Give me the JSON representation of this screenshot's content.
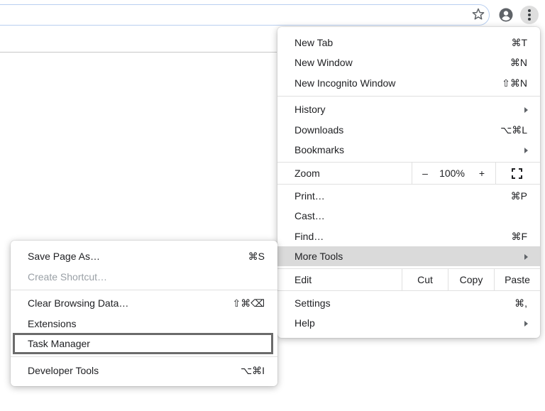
{
  "menu": {
    "new_tab": {
      "label": "New Tab",
      "shortcut": "⌘T"
    },
    "new_window": {
      "label": "New Window",
      "shortcut": "⌘N"
    },
    "new_incognito": {
      "label": "New Incognito Window",
      "shortcut": "⇧⌘N"
    },
    "history": {
      "label": "History"
    },
    "downloads": {
      "label": "Downloads",
      "shortcut": "⌥⌘L"
    },
    "bookmarks": {
      "label": "Bookmarks"
    },
    "zoom": {
      "label": "Zoom",
      "minus": "–",
      "level": "100%",
      "plus": "+"
    },
    "print": {
      "label": "Print…",
      "shortcut": "⌘P"
    },
    "cast": {
      "label": "Cast…"
    },
    "find": {
      "label": "Find…",
      "shortcut": "⌘F"
    },
    "more_tools": {
      "label": "More Tools"
    },
    "edit": {
      "label": "Edit",
      "cut": "Cut",
      "copy": "Copy",
      "paste": "Paste"
    },
    "settings": {
      "label": "Settings",
      "shortcut": "⌘,"
    },
    "help": {
      "label": "Help"
    }
  },
  "submenu": {
    "save_page": {
      "label": "Save Page As…",
      "shortcut": "⌘S"
    },
    "create_shortcut": {
      "label": "Create Shortcut…"
    },
    "clear_data": {
      "label": "Clear Browsing Data…",
      "shortcut": "⇧⌘⌫"
    },
    "extensions": {
      "label": "Extensions"
    },
    "task_manager": {
      "label": "Task Manager"
    },
    "developer_tools": {
      "label": "Developer Tools",
      "shortcut": "⌥⌘I"
    }
  },
  "toolbar": {
    "icons": [
      "star-icon",
      "profile-icon",
      "kebab-menu-icon"
    ]
  },
  "colors": {
    "highlight": "#dadada",
    "separator": "#e0e0e0",
    "outline": "#6b6b6b"
  }
}
